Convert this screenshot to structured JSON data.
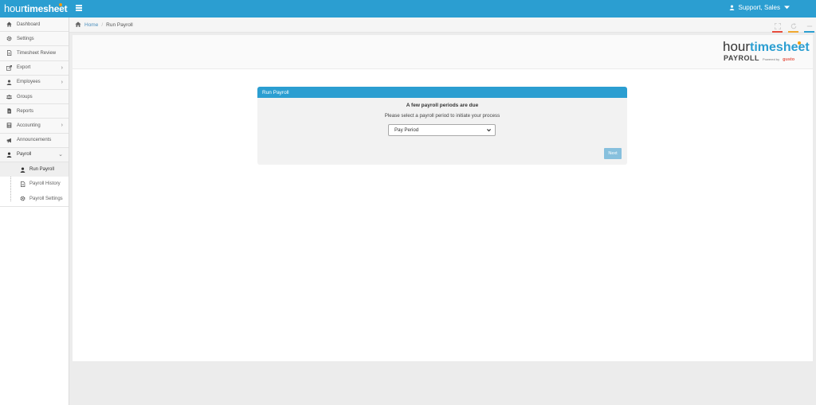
{
  "app": {
    "logo_hour": "hour",
    "logo_timesheet": "timesheet",
    "user_label": "Support, Sales"
  },
  "sidebar": {
    "items": [
      {
        "label": "Dashboard",
        "icon": "home-icon"
      },
      {
        "label": "Settings",
        "icon": "gear-icon"
      },
      {
        "label": "Timesheet Review",
        "icon": "document-icon"
      },
      {
        "label": "Export",
        "icon": "export-icon",
        "has_submenu": true
      },
      {
        "label": "Employees",
        "icon": "user-icon",
        "has_submenu": true
      },
      {
        "label": "Groups",
        "icon": "users-icon"
      },
      {
        "label": "Reports",
        "icon": "report-icon"
      },
      {
        "label": "Accounting",
        "icon": "calculator-icon",
        "has_submenu": true
      },
      {
        "label": "Announcements",
        "icon": "megaphone-icon"
      },
      {
        "label": "Payroll",
        "icon": "user-icon",
        "expanded": true
      }
    ],
    "payroll_sub": [
      {
        "label": "Run Payroll",
        "icon": "user-icon",
        "active": true
      },
      {
        "label": "Payroll History",
        "icon": "document-icon"
      },
      {
        "label": "Payroll Settings",
        "icon": "gear-icon"
      }
    ]
  },
  "breadcrumb": {
    "home": "Home",
    "separator": "/",
    "current": "Run Payroll"
  },
  "brand": {
    "hour": "hour",
    "timesheet": "timesheet",
    "payroll": "PAYROLL",
    "powered_by": "Powered by",
    "gusto": "gusto"
  },
  "panel": {
    "title": "Run Payroll",
    "heading": "A few payroll periods are due",
    "instruction": "Please select a payroll period to initiate your process",
    "select_value": "Pay Period",
    "next_label": "Next"
  },
  "colors": {
    "accent": "#2b9ed1",
    "button_disabled": "#87c0dd",
    "control_red": "#e74c3c",
    "control_orange": "#f0a830",
    "control_blue": "#2b9ed1",
    "logo_dot": "#f39c12",
    "gusto": "#e5584a"
  }
}
